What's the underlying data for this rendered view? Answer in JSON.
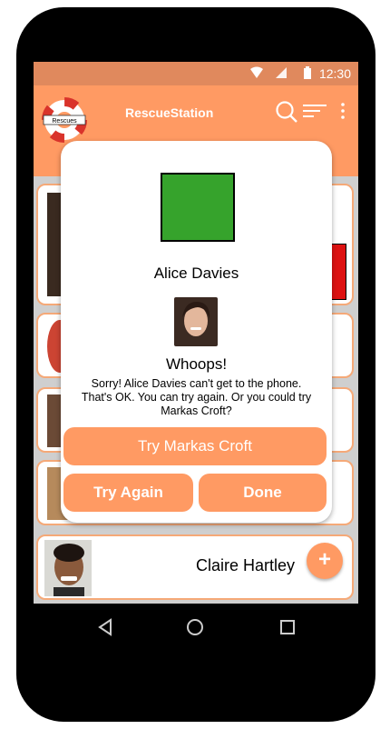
{
  "status": {
    "time": "12:30"
  },
  "app": {
    "title": "RescueStation",
    "logo_text": "Rescues"
  },
  "contacts": [
    {
      "name": ""
    },
    {
      "name": ""
    },
    {
      "name": ""
    },
    {
      "name": ""
    },
    {
      "name": "Claire Hartley"
    }
  ],
  "fab": {
    "label": "+"
  },
  "dialog": {
    "name": "Alice Davies",
    "title": "Whoops!",
    "message": "Sorry! Alice Davies can't get to the phone. That's OK. You can try again. Or you could try Markas Croft?",
    "try_other_label": "Try Markas Croft",
    "try_again_label": "Try Again",
    "done_label": "Done"
  },
  "colors": {
    "accent": "#ff9a63",
    "status": "#e0895d",
    "status_square": "#36a32c",
    "card_border": "#f5a978"
  }
}
